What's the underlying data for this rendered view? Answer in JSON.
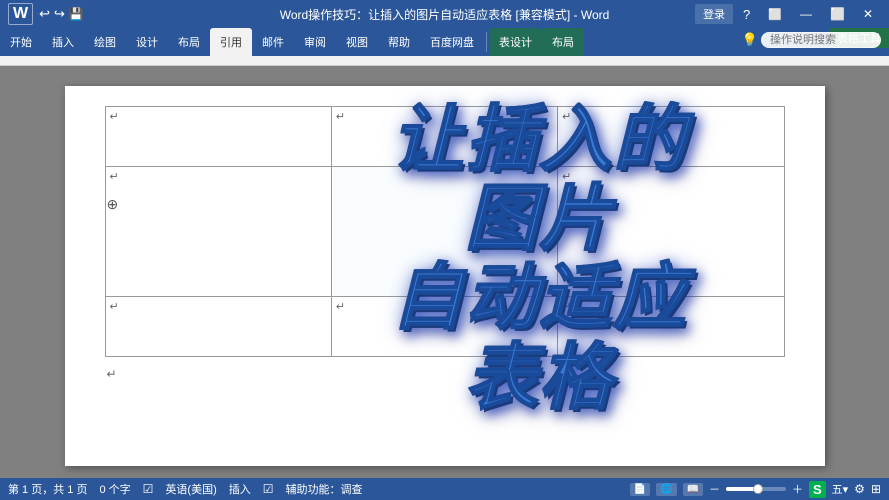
{
  "titlebar": {
    "title": "Word操作技巧：让插入的图片自动适应表格 [兼容模式] - Word",
    "app": "Word",
    "login_btn": "登录",
    "quick_access": [
      "←",
      "→",
      "💾"
    ],
    "window_btns": [
      "—",
      "⬜",
      "✕"
    ],
    "context_label": "表格工具"
  },
  "ribbon": {
    "main_tabs": [
      {
        "label": "开始",
        "active": false
      },
      {
        "label": "插入",
        "active": false
      },
      {
        "label": "绘图",
        "active": false
      },
      {
        "label": "设计",
        "active": false
      },
      {
        "label": "布局",
        "active": false
      },
      {
        "label": "引用",
        "active": true
      },
      {
        "label": "邮件",
        "active": false
      },
      {
        "label": "审阅",
        "active": false
      },
      {
        "label": "视图",
        "active": false
      },
      {
        "label": "帮助",
        "active": false
      },
      {
        "label": "百度网盘",
        "active": false
      },
      {
        "label": "表设计",
        "active": false
      },
      {
        "label": "布局",
        "active": false
      }
    ],
    "search_placeholder": "操作说明搜索",
    "search_label": "操作说明搜索"
  },
  "document": {
    "table": {
      "rows": 3,
      "cols": 3,
      "cells": [
        [
          "↵",
          "↵",
          "↵"
        ],
        [
          "↵",
          "",
          "↵"
        ],
        [
          "↵",
          "↵",
          "↵"
        ]
      ]
    },
    "overlay_text": "让插入的\n图片\n自动适应\n表格"
  },
  "statusbar": {
    "pages": "第 1 页，共 1 页",
    "words": "0 个字",
    "detect_icon": "☑",
    "language": "英语(美国)",
    "insert_mode": "插入",
    "track_icon": "☑",
    "accessibility": "辅助功能：调查",
    "view_buttons": [
      "■",
      "□",
      "▦"
    ],
    "zoom": "五▾",
    "zoom_pct": "100%",
    "brand_logo": "S"
  }
}
